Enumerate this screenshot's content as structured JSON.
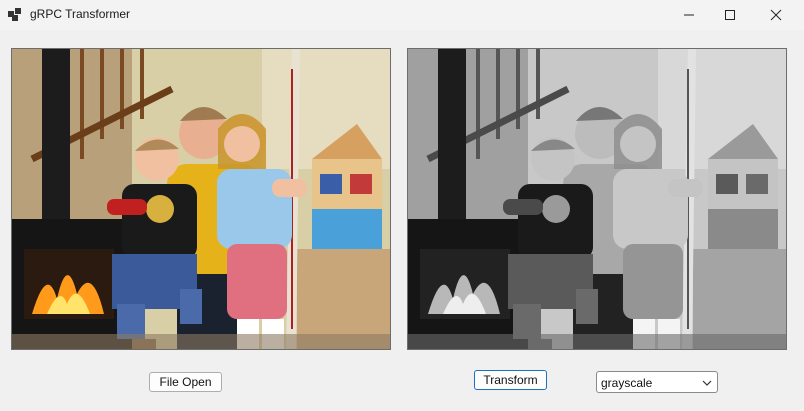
{
  "window": {
    "title": "gRPC Transformer",
    "icons": [
      "app-icon",
      "minimize-icon",
      "maximize-icon",
      "close-icon"
    ]
  },
  "left_panel": {
    "image_description": "family photo original color"
  },
  "right_panel": {
    "image_description": "family photo grayscale"
  },
  "buttons": {
    "file_open": "File Open",
    "transform": "Transform"
  },
  "transform_select": {
    "value": "grayscale"
  },
  "colors": {
    "transform_button_border": "#1f6fbf",
    "window_bg": "#f0f0f0"
  }
}
